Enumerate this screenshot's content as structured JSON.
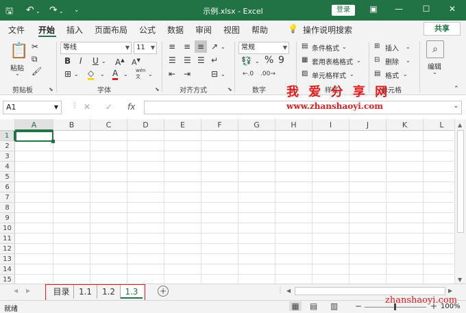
{
  "titlebar": {
    "save_icon": "save-icon",
    "undo_icon": "undo-icon",
    "redo_icon": "redo-icon",
    "customize_icon": "dropdown-icon",
    "title": "示例.xlsx  -  Excel",
    "login": "登录",
    "ribbon_display_icon": "ribbon-display-icon",
    "minimize": "—",
    "maximize": "☐",
    "close": "✕"
  },
  "menu": {
    "tabs": [
      "文件",
      "开始",
      "插入",
      "页面布局",
      "公式",
      "数据",
      "审阅",
      "视图",
      "帮助"
    ],
    "active": "开始",
    "tell_me": "操作说明搜索",
    "share": "共享"
  },
  "ribbon": {
    "clipboard": {
      "label": "剪贴板",
      "paste": "粘贴"
    },
    "font": {
      "label": "字体",
      "font_name": "等线",
      "font_size": "11",
      "bold": "B",
      "italic": "I",
      "underline": "U",
      "phonetic": "wén"
    },
    "alignment": {
      "label": "对齐方式"
    },
    "number": {
      "label": "数字",
      "format": "常规",
      "percent": "%",
      "comma": "9"
    },
    "styles": {
      "label": "样式",
      "conditional": "条件格式",
      "table": "套用表格格式",
      "cell_styles": "单元格样式"
    },
    "cells": {
      "label": "单元格",
      "insert": "插入",
      "delete": "删除",
      "format": "格式"
    },
    "editing": {
      "label": "编辑"
    }
  },
  "watermark": {
    "line1": "我 爱 分 享 网",
    "line2": "www.zhanshaoyi.com",
    "bottom": "zhanshaoyi.com"
  },
  "formula_bar": {
    "name_box": "A1",
    "cancel": "✕",
    "enter": "✓",
    "fx": "fx",
    "value": ""
  },
  "grid": {
    "columns": [
      "A",
      "B",
      "C",
      "D",
      "E",
      "F",
      "G",
      "H",
      "I",
      "J",
      "K",
      "L"
    ],
    "rows": [
      "1",
      "2",
      "3",
      "4",
      "5",
      "6",
      "7",
      "8",
      "9",
      "10",
      "11",
      "12",
      "13",
      "14",
      "15"
    ],
    "selected": "A1"
  },
  "sheets": {
    "tabs": [
      "目录",
      "1.1",
      "1.2",
      "1.3"
    ],
    "active": "1.3",
    "add": "+"
  },
  "status": {
    "ready": "就绪",
    "zoom": "100%",
    "zoom_minus": "−",
    "zoom_plus": "+"
  },
  "colors": {
    "excel_green": "#217346",
    "highlight_red": "#e21b1b"
  }
}
